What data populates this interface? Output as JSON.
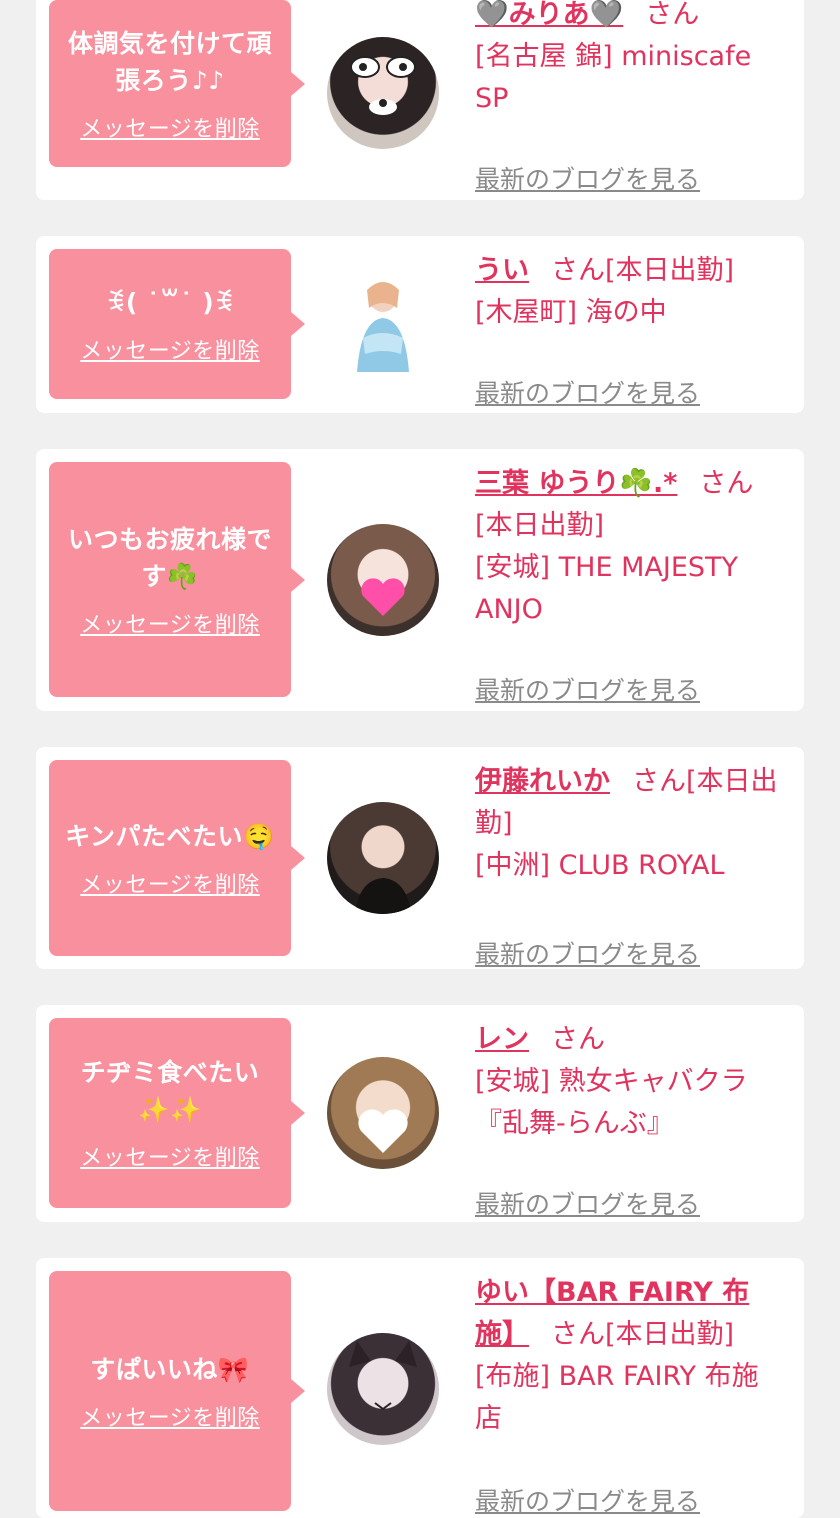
{
  "colors": {
    "accent": "#e0335e",
    "bubble": "#f9909e",
    "card": "#ffffff",
    "background": "#f0f0f0",
    "muted": "#8a8a8a"
  },
  "delete_label": "メッセージを削除",
  "blog_label": "最新のブログを見る",
  "san_label": "さん",
  "items": [
    {
      "message": "体調気を付けて頑張ろう♪♪",
      "name": "🩶みりあ🩶",
      "info": [
        "[名古屋 錦] miniscafe SP"
      ]
    },
    {
      "message": "ꉂ( ˙꒳˙ )ꉂ",
      "name": "うい",
      "tag": "[本日出勤]",
      "info": [
        "[木屋町] 海の中"
      ]
    },
    {
      "message": "いつもお疲れ様です☘️",
      "name": "三葉 ゆうり☘️.*",
      "info": [
        "[本日出勤]",
        "[安城] THE MAJESTY ANJO"
      ]
    },
    {
      "message": "キンパたべたい🤤",
      "name": "伊藤れいか",
      "tag": "[本日出勤]",
      "info": [
        "[中洲] CLUB ROYAL"
      ]
    },
    {
      "message": "チヂミ食べたい✨✨",
      "name": "レン",
      "info": [
        "[安城] 熟女キャバクラ『乱舞-らんぶ』"
      ]
    },
    {
      "message": "すぱいいね🎀",
      "name": "ゆい【BAR FAIRY 布施】",
      "tag": "[本日出勤]",
      "info": [
        "[布施] BAR FAIRY 布施店"
      ]
    }
  ]
}
